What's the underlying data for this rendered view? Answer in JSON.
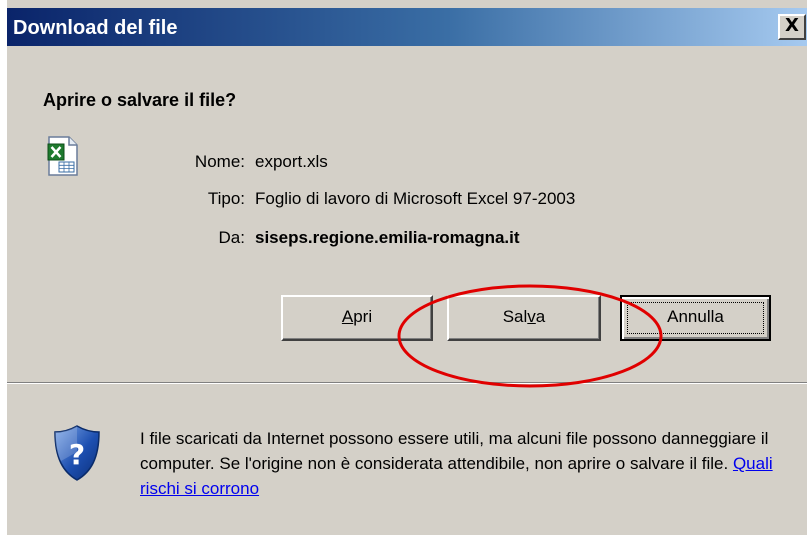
{
  "window": {
    "title": "Download del file",
    "close_glyph": "X"
  },
  "question": "Aprire o salvare il file?",
  "file": {
    "icon": "excel-file-icon",
    "name_label": "Nome:",
    "name_value": "export.xls",
    "type_label": "Tipo:",
    "type_value": "Foglio di lavoro di Microsoft Excel 97-2003",
    "from_label": "Da:",
    "from_value": "siseps.regione.emilia-romagna.it"
  },
  "buttons": {
    "open": {
      "before": "",
      "mnemonic": "A",
      "after": "pri"
    },
    "save": {
      "before": "Sal",
      "mnemonic": "v",
      "after": "a"
    },
    "cancel": {
      "label": "Annulla"
    }
  },
  "warning": {
    "icon": "shield-question-icon",
    "text": "I file scaricati da Internet possono essere utili, ma alcuni file possono danneggiare il computer. Se l'origine non è considerata attendibile, non aprire o salvare il file.",
    "link": "Quali rischi si corrono"
  },
  "annotation": {
    "color": "#e00000"
  },
  "colors": {
    "dialog_bg": "#d4d0c8",
    "title_start": "#0a246a",
    "title_end": "#a6caf0",
    "link": "#0000ee"
  }
}
